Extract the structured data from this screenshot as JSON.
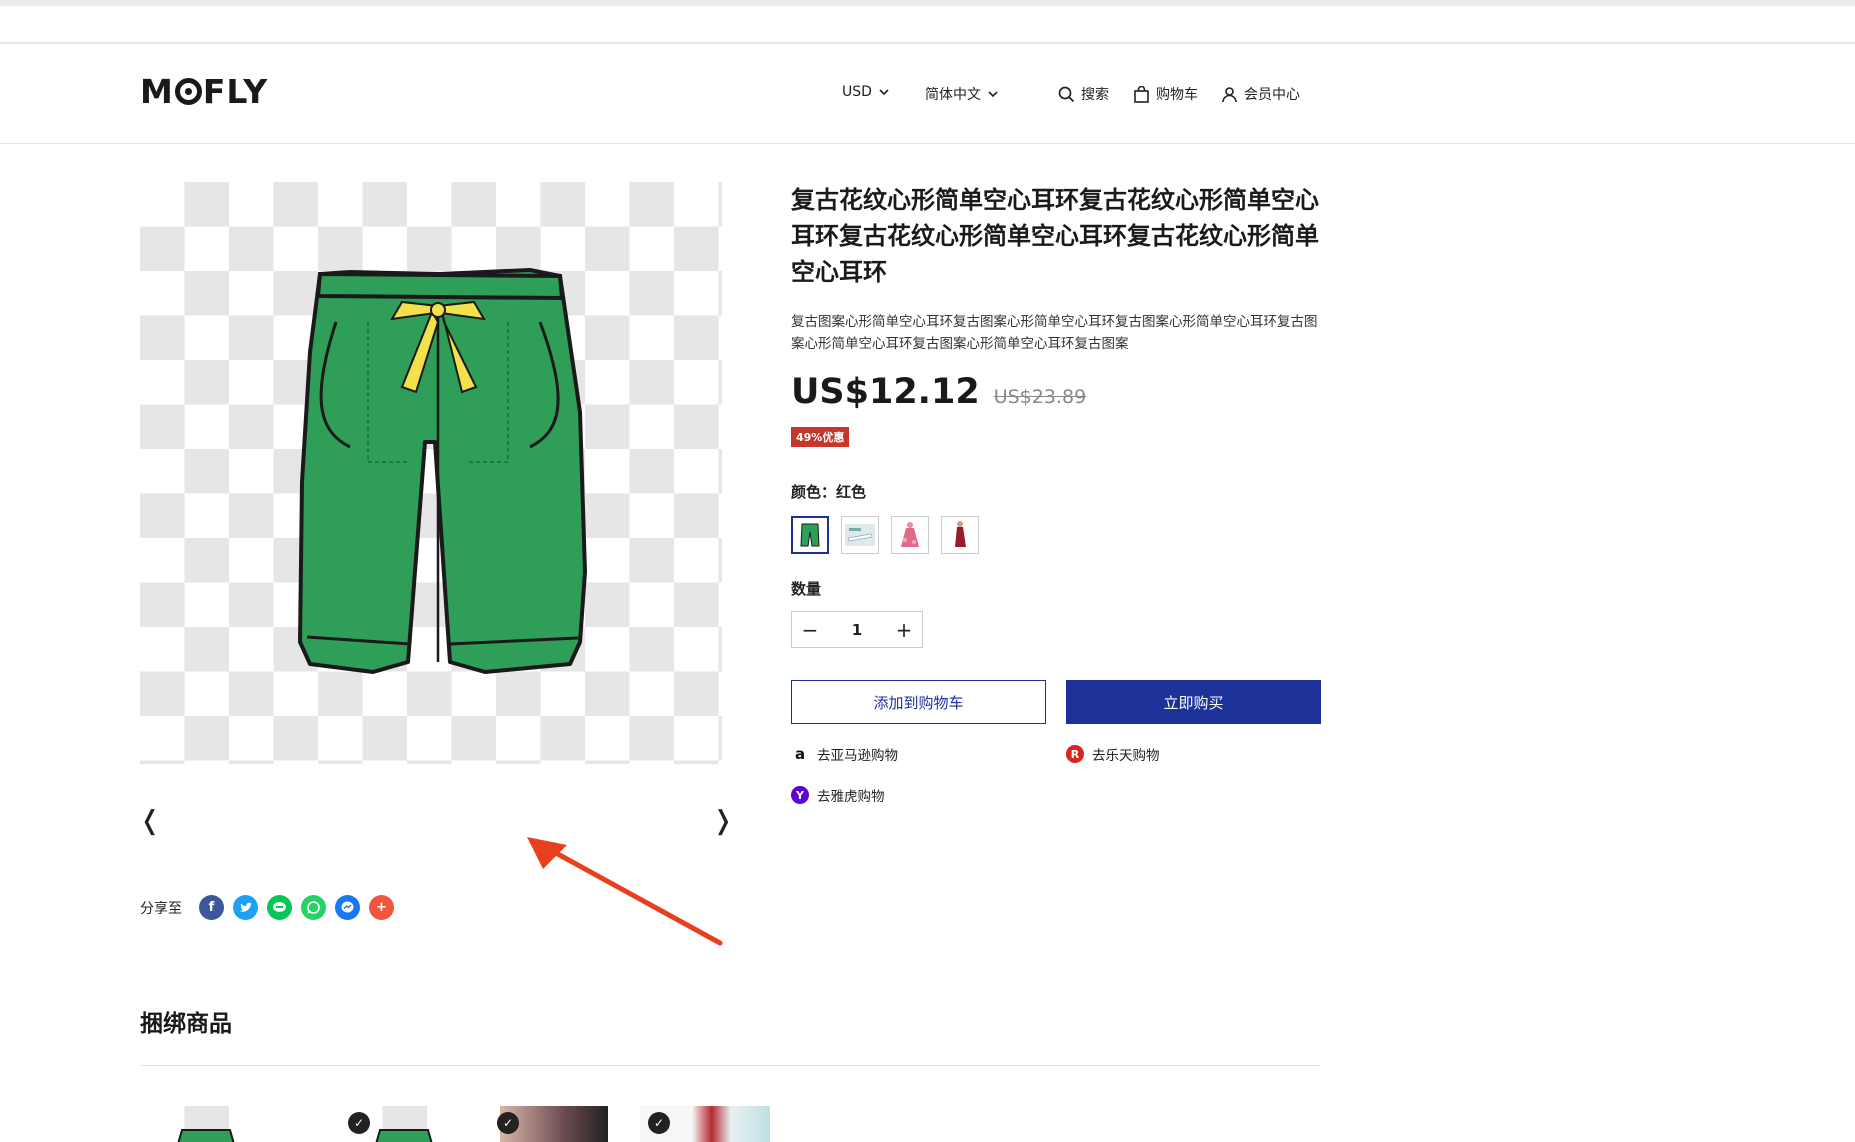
{
  "header": {
    "logo": "MOFLY",
    "currency": "USD",
    "language": "简体中文",
    "search": "搜索",
    "cart": "购物车",
    "member": "会员中心"
  },
  "gallery": {
    "prev": "❬",
    "next": "❭"
  },
  "share": {
    "label": "分享至",
    "icons": [
      "facebook-icon",
      "twitter-icon",
      "line-icon",
      "whatsapp-icon",
      "messenger-icon",
      "more-icon"
    ]
  },
  "product": {
    "title": "复古花纹心形简单空心耳环复古花纹心形简单空心耳环复古花纹心形简单空心耳环复古花纹心形简单空心耳环",
    "subtitle": "复古图案心形简单空心耳环复古图案心形简单空心耳环复古图案心形简单空心耳环复古图案心形简单空心耳环复古图案心形简单空心耳环复古图案",
    "price": "US$12.12",
    "original_price": "US$23.89",
    "discount": "49%优惠",
    "color_label": "颜色：",
    "color_value": "红色",
    "qty_label": "数量",
    "qty": "1",
    "add_to_cart": "添加到购物车",
    "buy_now": "立即购买"
  },
  "external": {
    "amazon": "去亚马逊购物",
    "rakuten": "去乐天购物",
    "yahoo": "去雅虎购物"
  },
  "bundle": {
    "title": "捆绑商品"
  },
  "colors": {
    "accent": "#1c3299",
    "badge": "#c8352b",
    "pants": "#2f9e58",
    "annotation_arrow": "#e8401f"
  }
}
